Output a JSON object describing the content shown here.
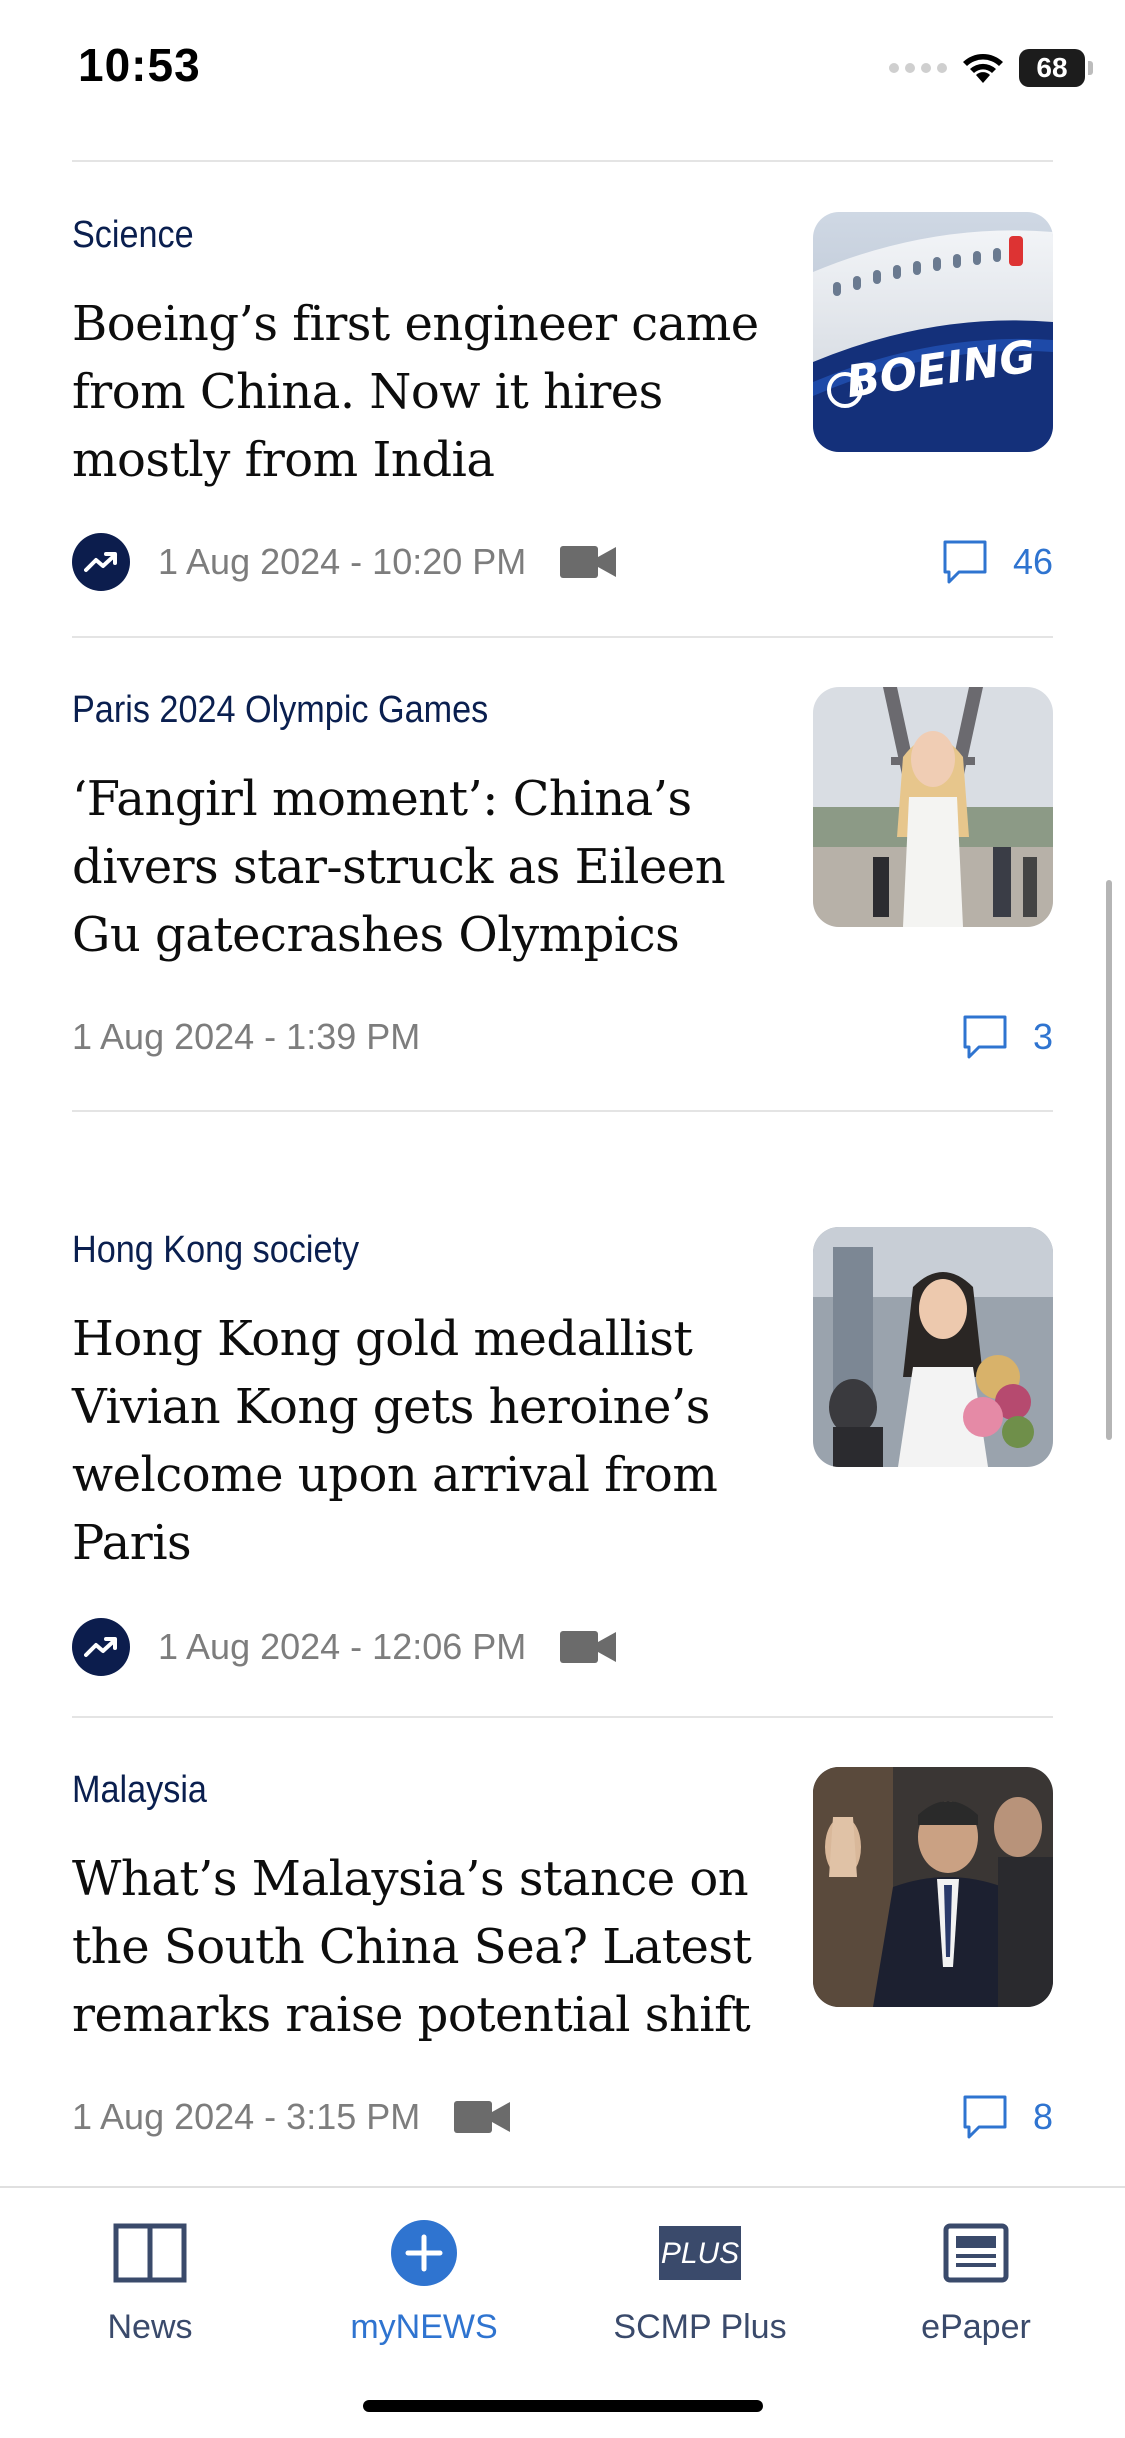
{
  "status_bar": {
    "time": "10:53",
    "battery": "68"
  },
  "articles": [
    {
      "section": "Science",
      "headline_lines": [
        "Boeing’s first engineer came",
        "from China. Now it hires",
        "mostly from India"
      ],
      "date": "1 Aug 2024 - 10:20 PM",
      "trending": true,
      "video": true,
      "comments": "46"
    },
    {
      "section": "Paris 2024 Olympic Games",
      "headline_lines": [
        "‘Fangirl moment’: China’s",
        "divers star-struck as Eileen",
        "Gu gatecrashes Olympics"
      ],
      "date": "1 Aug 2024 - 1:39 PM",
      "trending": false,
      "video": false,
      "comments": "3"
    },
    {
      "section": "Hong Kong society",
      "headline_lines": [
        "Hong Kong gold medallist",
        "Vivian Kong gets heroine’s",
        "welcome upon arrival from",
        "Paris"
      ],
      "date": "1 Aug 2024 - 12:06 PM",
      "trending": true,
      "video": true,
      "comments": ""
    },
    {
      "section": "Malaysia",
      "headline_lines": [
        "What’s Malaysia’s stance on",
        "the South China Sea? Latest",
        "remarks raise potential shift"
      ],
      "date": "1 Aug 2024 - 3:15 PM",
      "trending": false,
      "video": true,
      "comments": "8"
    }
  ],
  "thumb_text": {
    "boeing": "BOEING"
  },
  "tabs": [
    {
      "label": "News",
      "icon": "book-icon",
      "active": false
    },
    {
      "label": "myNEWS",
      "icon": "plus-circle-icon",
      "active": true
    },
    {
      "label": "SCMP Plus",
      "icon": "plus-badge-icon",
      "badge": "PLUS",
      "active": false
    },
    {
      "label": "ePaper",
      "icon": "newspaper-icon",
      "active": false
    }
  ],
  "colors": {
    "section": "#0a1f4f",
    "accent_blue": "#2f74d0",
    "trend_badge": "#0c1d4d",
    "meta_grey": "#7d7d7d"
  }
}
